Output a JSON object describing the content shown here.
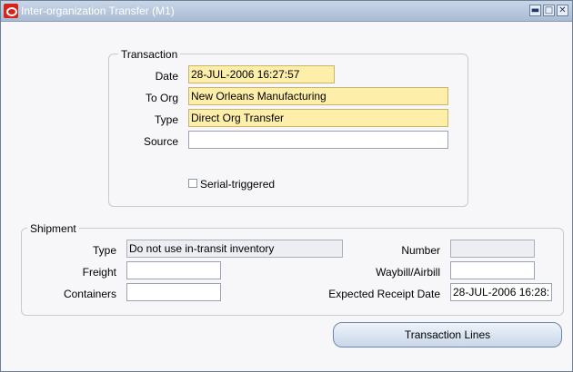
{
  "window": {
    "title": "Inter-organization Transfer (M1)",
    "controls": {
      "minimize": "▬",
      "restore": "□",
      "close": "✕"
    }
  },
  "transaction": {
    "legend": "Transaction",
    "date_label": "Date",
    "date_value": "28-JUL-2006 16:27:57",
    "to_org_label": "To Org",
    "to_org_value": "New Orleans Manufacturing",
    "type_label": "Type",
    "type_value": "Direct Org Transfer",
    "source_label": "Source",
    "source_value": "",
    "serial_label": "Serial-triggered",
    "serial_checked": false
  },
  "shipment": {
    "legend": "Shipment",
    "type_label": "Type",
    "type_value": "Do not use in-transit inventory",
    "freight_label": "Freight",
    "freight_value": "",
    "containers_label": "Containers",
    "containers_value": "",
    "number_label": "Number",
    "number_value": "",
    "waybill_label": "Waybill/Airbill",
    "waybill_value": "",
    "expected_label": "Expected Receipt Date",
    "expected_value": "28-JUL-2006 16:28:"
  },
  "actions": {
    "transaction_lines_label": "Transaction Lines"
  }
}
